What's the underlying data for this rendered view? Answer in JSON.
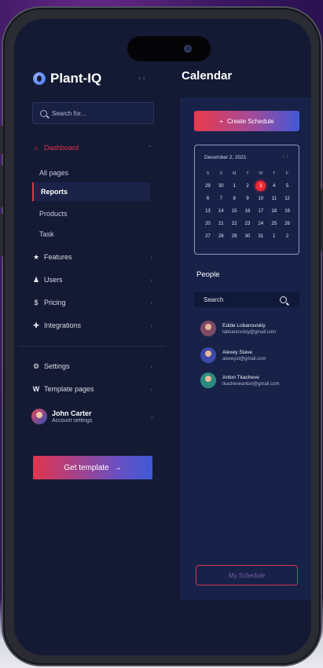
{
  "app": {
    "name": "Plant-IQ"
  },
  "sidebar": {
    "search_placeholder": "Search for...",
    "dashboard_label": "Dashboard",
    "sub_items": [
      "All pages",
      "Reports",
      "Products",
      "Task"
    ],
    "active_sub_item": "Reports",
    "items": [
      {
        "label": "Features",
        "icon": "star-icon"
      },
      {
        "label": "Users",
        "icon": "user-icon"
      },
      {
        "label": "Pricing",
        "icon": "dollar-icon"
      },
      {
        "label": "Integrations",
        "icon": "puzzle-icon"
      }
    ],
    "bottom_items": [
      {
        "label": "Settings",
        "icon": "gear-icon"
      },
      {
        "label": "Template pages",
        "icon": "w-icon"
      }
    ],
    "profile": {
      "name": "John Carter",
      "subtitle": "Account settings"
    },
    "cta_label": "Get template",
    "cta_arrow": "→"
  },
  "calendar": {
    "title": "Calendar",
    "create_label": "Create Schedule",
    "create_icon": "+",
    "month_label": "December 2, 2021",
    "weekdays": [
      "S",
      "S",
      "M",
      "T",
      "W",
      "T",
      "F"
    ],
    "days": [
      [
        "29",
        "30",
        "1",
        "2",
        "3",
        "4",
        "5"
      ],
      [
        "6",
        "7",
        "8",
        "9",
        "10",
        "11",
        "12"
      ],
      [
        "13",
        "14",
        "15",
        "16",
        "17",
        "18",
        "19"
      ],
      [
        "20",
        "21",
        "22",
        "23",
        "24",
        "25",
        "26"
      ],
      [
        "27",
        "28",
        "29",
        "30",
        "31",
        "1",
        "2"
      ]
    ],
    "selected_day": "3"
  },
  "people": {
    "title": "People",
    "search_placeholder": "Search",
    "list": [
      {
        "name": "Eddie Lobanovskiy",
        "email": "laboanovskiy@gmail.com"
      },
      {
        "name": "Alexey Stave",
        "email": "alexeyst@gmail.com"
      },
      {
        "name": "Anton Tkacheve",
        "email": "tkacheveanton@gmail.com"
      }
    ]
  },
  "footer": {
    "my_schedule_label": "My Schedule"
  },
  "colors": {
    "accent_red": "#e0334a",
    "accent_blue": "#4159d8",
    "panel": "#182249",
    "background": "#141a33"
  }
}
